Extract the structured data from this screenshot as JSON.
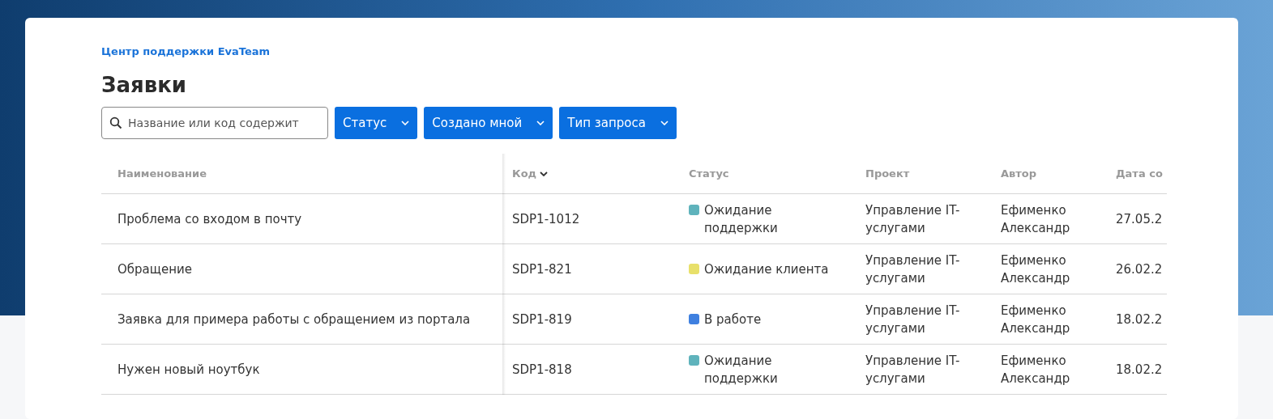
{
  "breadcrumb": "Центр поддержки EvaTeam",
  "title": "Заявки",
  "search": {
    "placeholder": "Название или код содержит"
  },
  "filters": [
    "Статус",
    "Создано мной",
    "Тип запроса"
  ],
  "table": {
    "columns": [
      {
        "label": "Наименование",
        "sorted": false
      },
      {
        "label": "Код",
        "sorted": true
      },
      {
        "label": "Статус",
        "sorted": false
      },
      {
        "label": "Проект",
        "sorted": false
      },
      {
        "label": "Автор",
        "sorted": false
      },
      {
        "label": "Дата со",
        "sorted": false
      }
    ],
    "rows": [
      {
        "name": "Проблема со входом в почту",
        "code": "SDP1-1012",
        "status": {
          "label": "Ожидание поддержки",
          "color": "#5fb3bc"
        },
        "project": "Управление IT-услугами",
        "author": "Ефименко Александр",
        "date": "27.05.2"
      },
      {
        "name": "Обращение",
        "code": "SDP1-821",
        "status": {
          "label": "Ожидание клиента",
          "color": "#e8e06a"
        },
        "project": "Управление IT-услугами",
        "author": "Ефименко Александр",
        "date": "26.02.2"
      },
      {
        "name": "Заявка для примера работы с обращением из портала",
        "code": "SDP1-819",
        "status": {
          "label": "В работе",
          "color": "#3f80e0"
        },
        "project": "Управление IT-услугами",
        "author": "Ефименко Александр",
        "date": "18.02.2"
      },
      {
        "name": "Нужен новый ноутбук",
        "code": "SDP1-818",
        "status": {
          "label": "Ожидание поддержки",
          "color": "#5fb3bc"
        },
        "project": "Управление IT-услугами",
        "author": "Ефименко Александр",
        "date": "18.02.2"
      }
    ]
  }
}
